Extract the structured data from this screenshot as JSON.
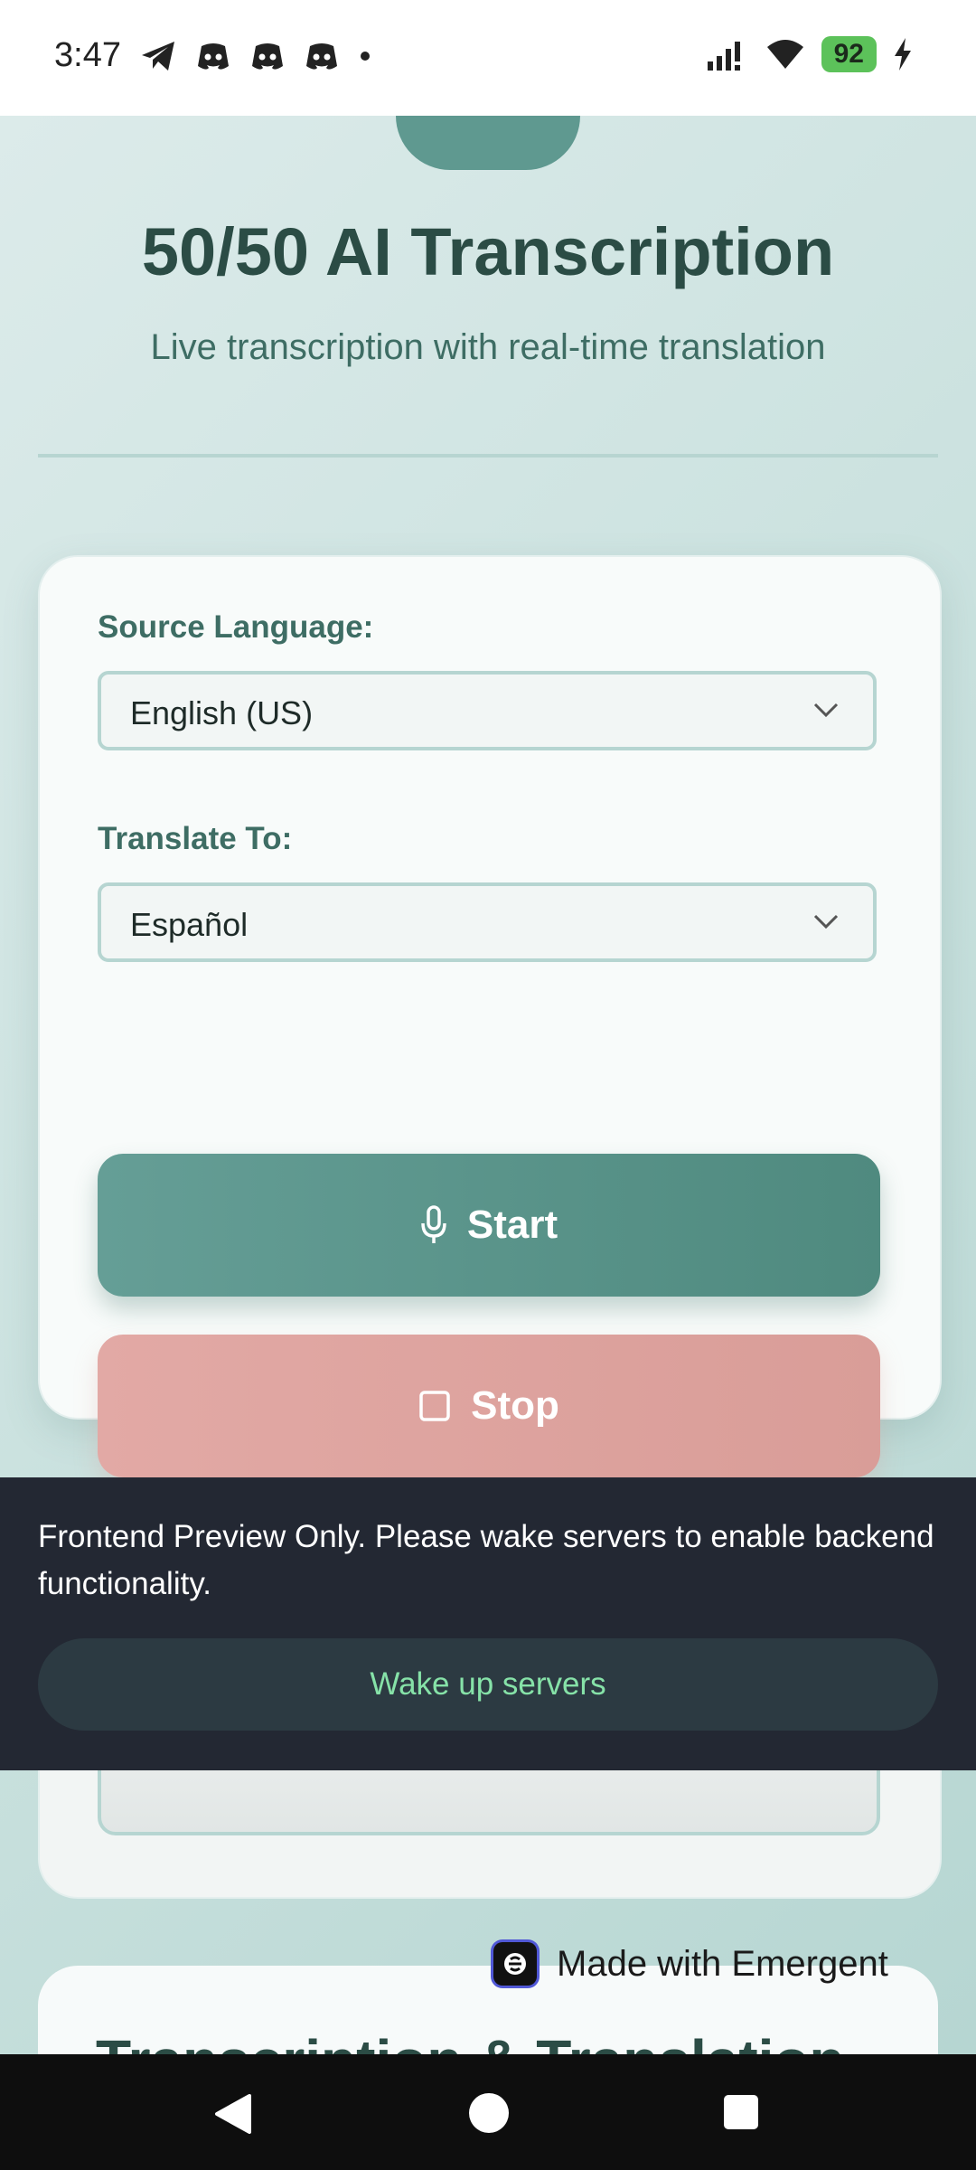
{
  "status_bar": {
    "time": "3:47",
    "battery": "92",
    "notification_icons": [
      "telegram-icon",
      "discord-icon",
      "discord-icon",
      "discord-icon",
      "dot-icon"
    ],
    "right_icons": [
      "signal-icon",
      "wifi-icon",
      "battery-icon",
      "charging-icon"
    ]
  },
  "header": {
    "title": "50/50 AI Transcription",
    "subtitle": "Live transcription with real-time translation"
  },
  "controls": {
    "source_label": "Source Language:",
    "source_value": "English (US)",
    "target_label": "Translate To:",
    "target_value": "Español",
    "start_label": "Start",
    "stop_label": "Stop"
  },
  "lower_section": {
    "title": "Transcription & Translation"
  },
  "banner": {
    "message": "Frontend Preview Only. Please wake servers to enable backend functionality.",
    "button_label": "Wake up servers"
  },
  "badge": {
    "text": "Made with Emergent"
  },
  "colors": {
    "accent": "#5f9990",
    "stop": "#dca39f",
    "banner_bg": "#232833",
    "wake_text": "#86e2a8"
  }
}
